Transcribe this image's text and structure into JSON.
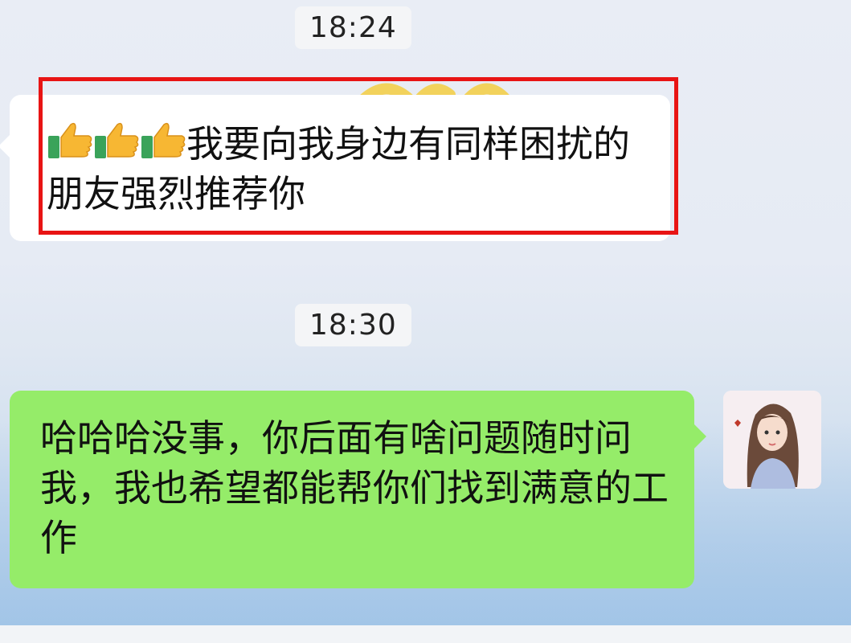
{
  "messages": [
    {
      "time": "18:24",
      "text": "我要向我身边有同样困扰的朋友强烈推荐你",
      "emoji": [
        "thumbs-up",
        "thumbs-up",
        "thumbs-up"
      ]
    },
    {
      "time": "18:30",
      "text": "哈哈哈没事，你后面有啥问题随时问我，我也希望都能帮你们找到满意的工作"
    }
  ],
  "colors": {
    "incoming_bubble": "#ffffff",
    "outgoing_bubble": "#95ec69",
    "highlight": "#e81414"
  }
}
